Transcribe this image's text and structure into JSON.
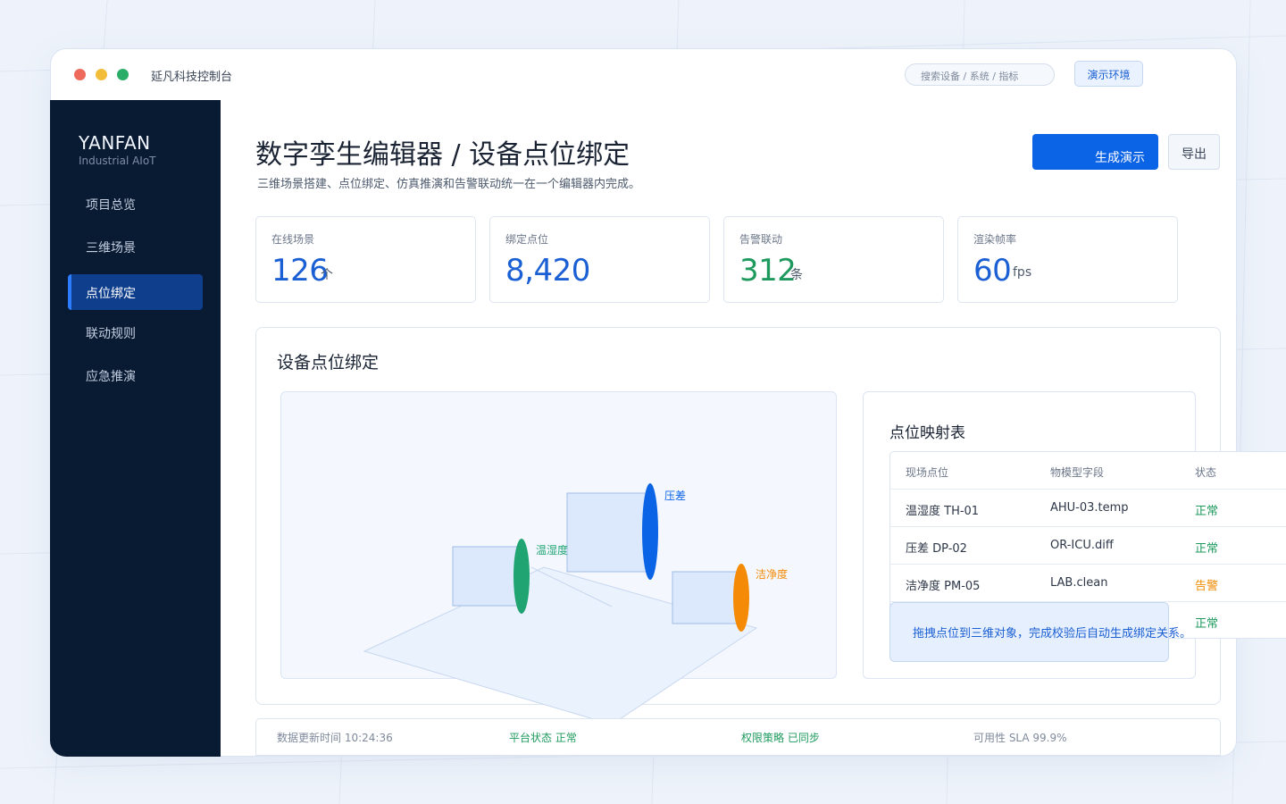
{
  "window": {
    "title": "延凡科技控制台",
    "search_placeholder": "搜索设备 / 系统 / 指标",
    "env_badge": "演示环境"
  },
  "sidebar": {
    "brand": "YANFAN",
    "brand_sub": "Industrial AIoT",
    "items": [
      {
        "label": "项目总览",
        "active": false
      },
      {
        "label": "三维场景",
        "active": false
      },
      {
        "label": "点位绑定",
        "active": true
      },
      {
        "label": "联动规则",
        "active": false
      },
      {
        "label": "应急推演",
        "active": false
      }
    ]
  },
  "header": {
    "title": "数字孪生编辑器 / 设备点位绑定",
    "subtitle": "三维场景搭建、点位绑定、仿真推演和告警联动统一在一个编辑器内完成。",
    "primary_button": "生成演示",
    "secondary_button": "导出"
  },
  "kpis": [
    {
      "label": "在线场景",
      "value": "126",
      "unit": "个",
      "color": "#1a5fd3"
    },
    {
      "label": "绑定点位",
      "value": "8,420",
      "unit": "",
      "color": "#1a5fd3"
    },
    {
      "label": "告警联动",
      "value": "312",
      "unit": "条",
      "color": "#1f9a5e"
    },
    {
      "label": "渲染帧率",
      "value": "60",
      "unit": "fps",
      "color": "#1a5fd3"
    }
  ],
  "binding_panel": {
    "title": "设备点位绑定",
    "scene_labels": {
      "humidity": "温湿度",
      "pressure": "压差",
      "cleanliness": "洁净度"
    },
    "colors": {
      "humidity": "#1fa472",
      "pressure": "#0b63e6",
      "cleanliness": "#f58a07"
    }
  },
  "mapping": {
    "title": "点位映射表",
    "headers": [
      "现场点位",
      "物模型字段",
      "状态"
    ],
    "rows": [
      {
        "point": "温湿度 TH-01",
        "field": "AHU-03.temp",
        "status": "正常",
        "level": "ok"
      },
      {
        "point": "压差 DP-02",
        "field": "OR-ICU.diff",
        "status": "正常",
        "level": "ok"
      },
      {
        "point": "洁净度 PM-05",
        "field": "LAB.clean",
        "status": "告警",
        "level": "warn"
      },
      {
        "point": "",
        "field": "",
        "status": "正常",
        "level": "ok"
      }
    ],
    "hint": "拖拽点位到三维对象，完成校验后自动生成绑定关系。"
  },
  "statusbar": {
    "update_time": "数据更新时间 10:24:36",
    "platform": "平台状态 正常",
    "policy": "权限策略 已同步",
    "sla": "可用性 SLA 99.9%"
  }
}
